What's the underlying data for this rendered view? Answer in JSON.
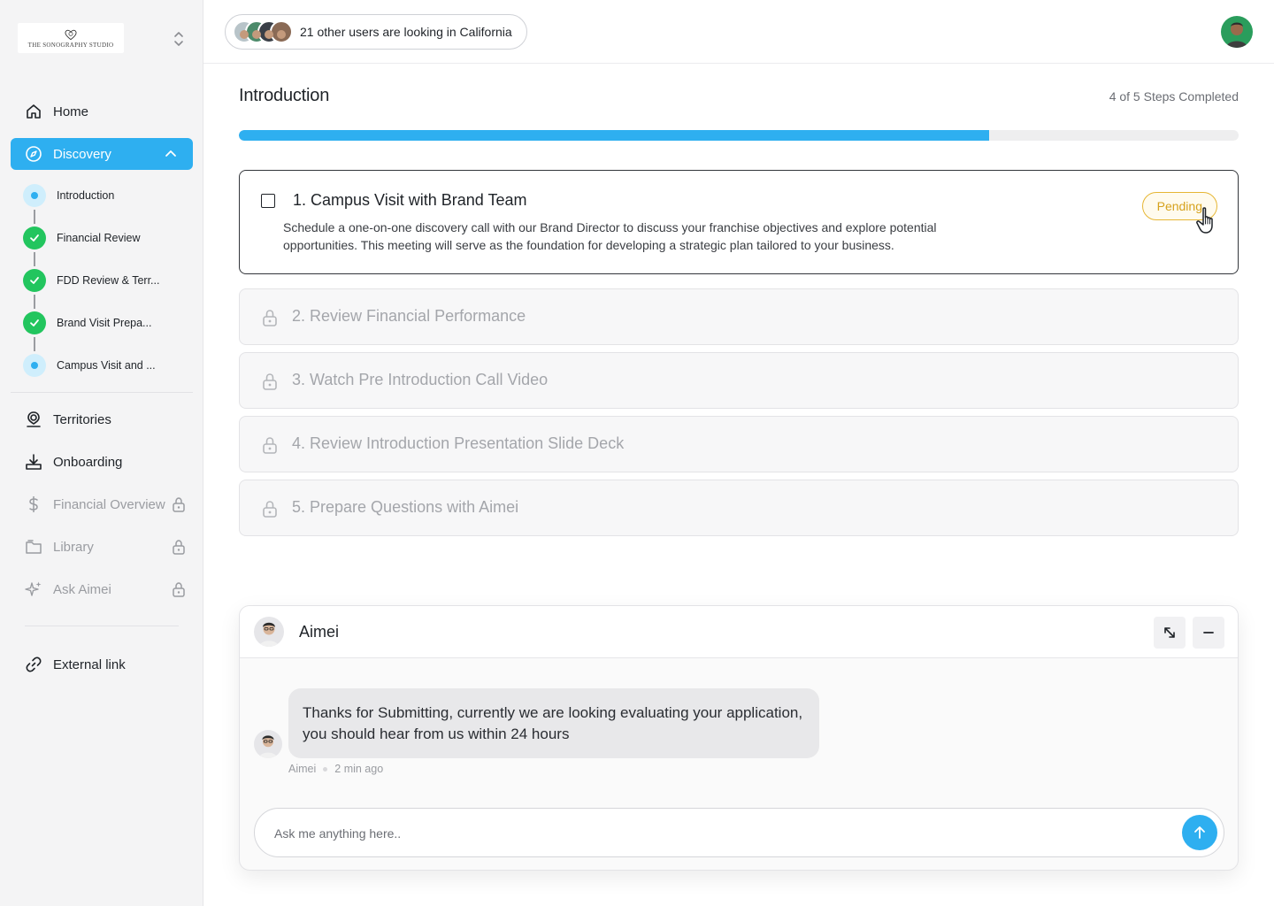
{
  "brand": {
    "logo_text": "THE SONOGRAPHY STUDIO"
  },
  "sidebar": {
    "nav_top": [
      {
        "label": "Home",
        "icon": "home-icon"
      },
      {
        "label": "Discovery",
        "icon": "compass-icon",
        "active": true
      }
    ],
    "steps": [
      {
        "label": "Introduction",
        "state": "current"
      },
      {
        "label": "Financial Review",
        "state": "done"
      },
      {
        "label": "FDD Review & Terr...",
        "state": "done"
      },
      {
        "label": "Brand Visit Prepa...",
        "state": "done"
      },
      {
        "label": "Campus Visit and ...",
        "state": "current"
      }
    ],
    "nav_bottom": [
      {
        "label": "Territories",
        "icon": "map-user-icon",
        "locked": false
      },
      {
        "label": "Onboarding",
        "icon": "download-tray-icon",
        "locked": false
      },
      {
        "label": "Financial Overview",
        "icon": "dollar-icon",
        "locked": true
      },
      {
        "label": "Library",
        "icon": "folder-icon",
        "locked": true
      },
      {
        "label": "Ask Aimei",
        "icon": "sparkle-icon",
        "locked": true
      }
    ],
    "external": {
      "label": "External link",
      "icon": "link-icon"
    }
  },
  "topbar": {
    "viewers_text": "21 other users are  looking in California",
    "viewer_colors": [
      "#b8c4c9",
      "#4c8a6a",
      "#3a3f47",
      "#8a6a55"
    ]
  },
  "main": {
    "title": "Introduction",
    "progress_text": "4  of  5 Steps Completed",
    "progress": {
      "completed": 4,
      "total": 5,
      "fraction": 0.75
    },
    "accent_color": "#2eaff0",
    "tasks": [
      {
        "title": "1. Campus Visit with Brand Team",
        "description": "Schedule a one-on-one discovery call with our Brand Director to discuss your franchise objectives and explore potential opportunities. This meeting will serve as the foundation for developing a strategic plan tailored to your business.",
        "status": "Pending",
        "locked": false
      },
      {
        "title": "2. Review Financial Performance",
        "locked": true
      },
      {
        "title": "3. Watch Pre Introduction Call Video",
        "locked": true
      },
      {
        "title": "4. Review Introduction Presentation Slide Deck",
        "locked": true
      },
      {
        "title": "5. Prepare Questions with Aimei",
        "locked": true
      }
    ]
  },
  "chat": {
    "name": "Aimei",
    "message": "Thanks for Submitting, currently we are looking evaluating your application, you should hear from us within 24 hours",
    "sender": "Aimei",
    "time": "2 min ago",
    "placeholder": "Ask me anything here.."
  }
}
